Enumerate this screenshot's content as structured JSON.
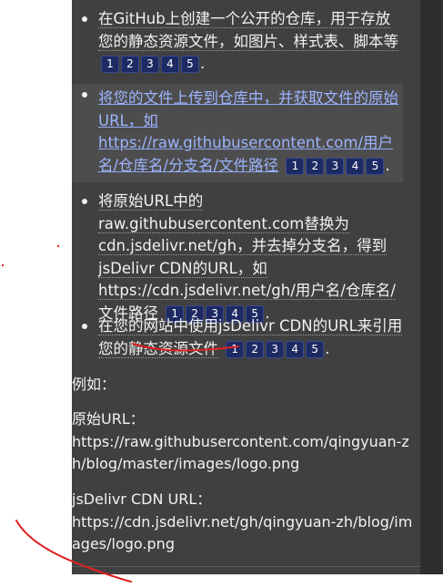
{
  "list": [
    {
      "text": "在GitHub上创建一个公开的仓库，用于存放您的静态资源文件，如图片、样式表、脚本等",
      "citations": [
        "1",
        "2",
        "3",
        "4",
        "5"
      ],
      "end": "."
    },
    {
      "text": "将您的文件上传到仓库中，并获取文件的原始URL，如",
      "link": "https://raw.githubusercontent.com/用户名/仓库名/分支名/文件路径",
      "citations": [
        "1",
        "2",
        "3",
        "4",
        "5"
      ],
      "end": "."
    },
    {
      "text": "将原始URL中的raw.githubusercontent.com替换为cdn.jsdelivr.net/gh，并去掉分支名，得到jsDelivr CDN的URL，如https://cdn.jsdelivr.net/gh/用户名/仓库名/文件路径",
      "citations": [
        "1",
        "2",
        "3",
        "4",
        "5"
      ],
      "end": "."
    },
    {
      "text": "在您的网站中使用jsDelivr CDN的URL来引用您的静态资源文件",
      "citations": [
        "1",
        "2",
        "3",
        "4",
        "5"
      ],
      "end": "."
    }
  ],
  "example": {
    "label": "例如：",
    "original_label": "原始URL：",
    "original_url": "https://raw.githubusercontent.com/qingyuan-zh/blog/master/images/logo.png",
    "cdn_label": "jsDelivr CDN URL：",
    "cdn_url": "https://cdn.jsdelivr.net/gh/qingyuan-zh/blog/images/logo.png"
  },
  "colors": {
    "panel_bg": "#404040",
    "highlight_bg": "#4d4d4d",
    "link": "#9db4ff",
    "citation_bg": "#1d2a63",
    "annotation_red": "#e02020"
  }
}
